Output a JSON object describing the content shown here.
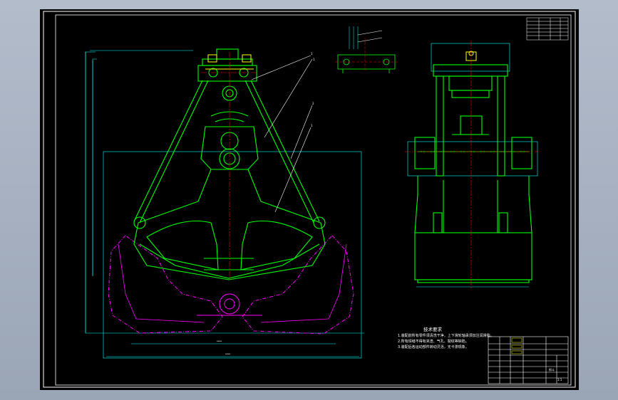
{
  "viewer": {
    "background_top": "#b3bccb",
    "background_bottom": "#9aa5b6",
    "sheet_color": "#000000"
  },
  "colors": {
    "frame": "#ffffff",
    "outline_green": "#00ff00",
    "open_position_magenta": "#ff00ff",
    "dimension_cyan": "#00ffff",
    "centerline_red": "#ff0000",
    "leader_white": "#ffffff",
    "accent_yellow": "#ffff00"
  },
  "leader_labels": {
    "l1": "1",
    "l2": "1",
    "l3": "2",
    "l4": "1"
  },
  "technical_requirements": {
    "title": "技术要求",
    "lines": [
      "1.装配前所有零件须清洗干净，上下滑轮轴承须加注润滑脂。",
      "2.所有焊缝不得有夹渣、气孔、裂纹等缺陷。",
      "3.装配后各运动部件转动灵活，无卡滞现象。"
    ]
  },
  "title_block": {
    "sheet_label": "抓斗",
    "scale_label": "1:1"
  }
}
